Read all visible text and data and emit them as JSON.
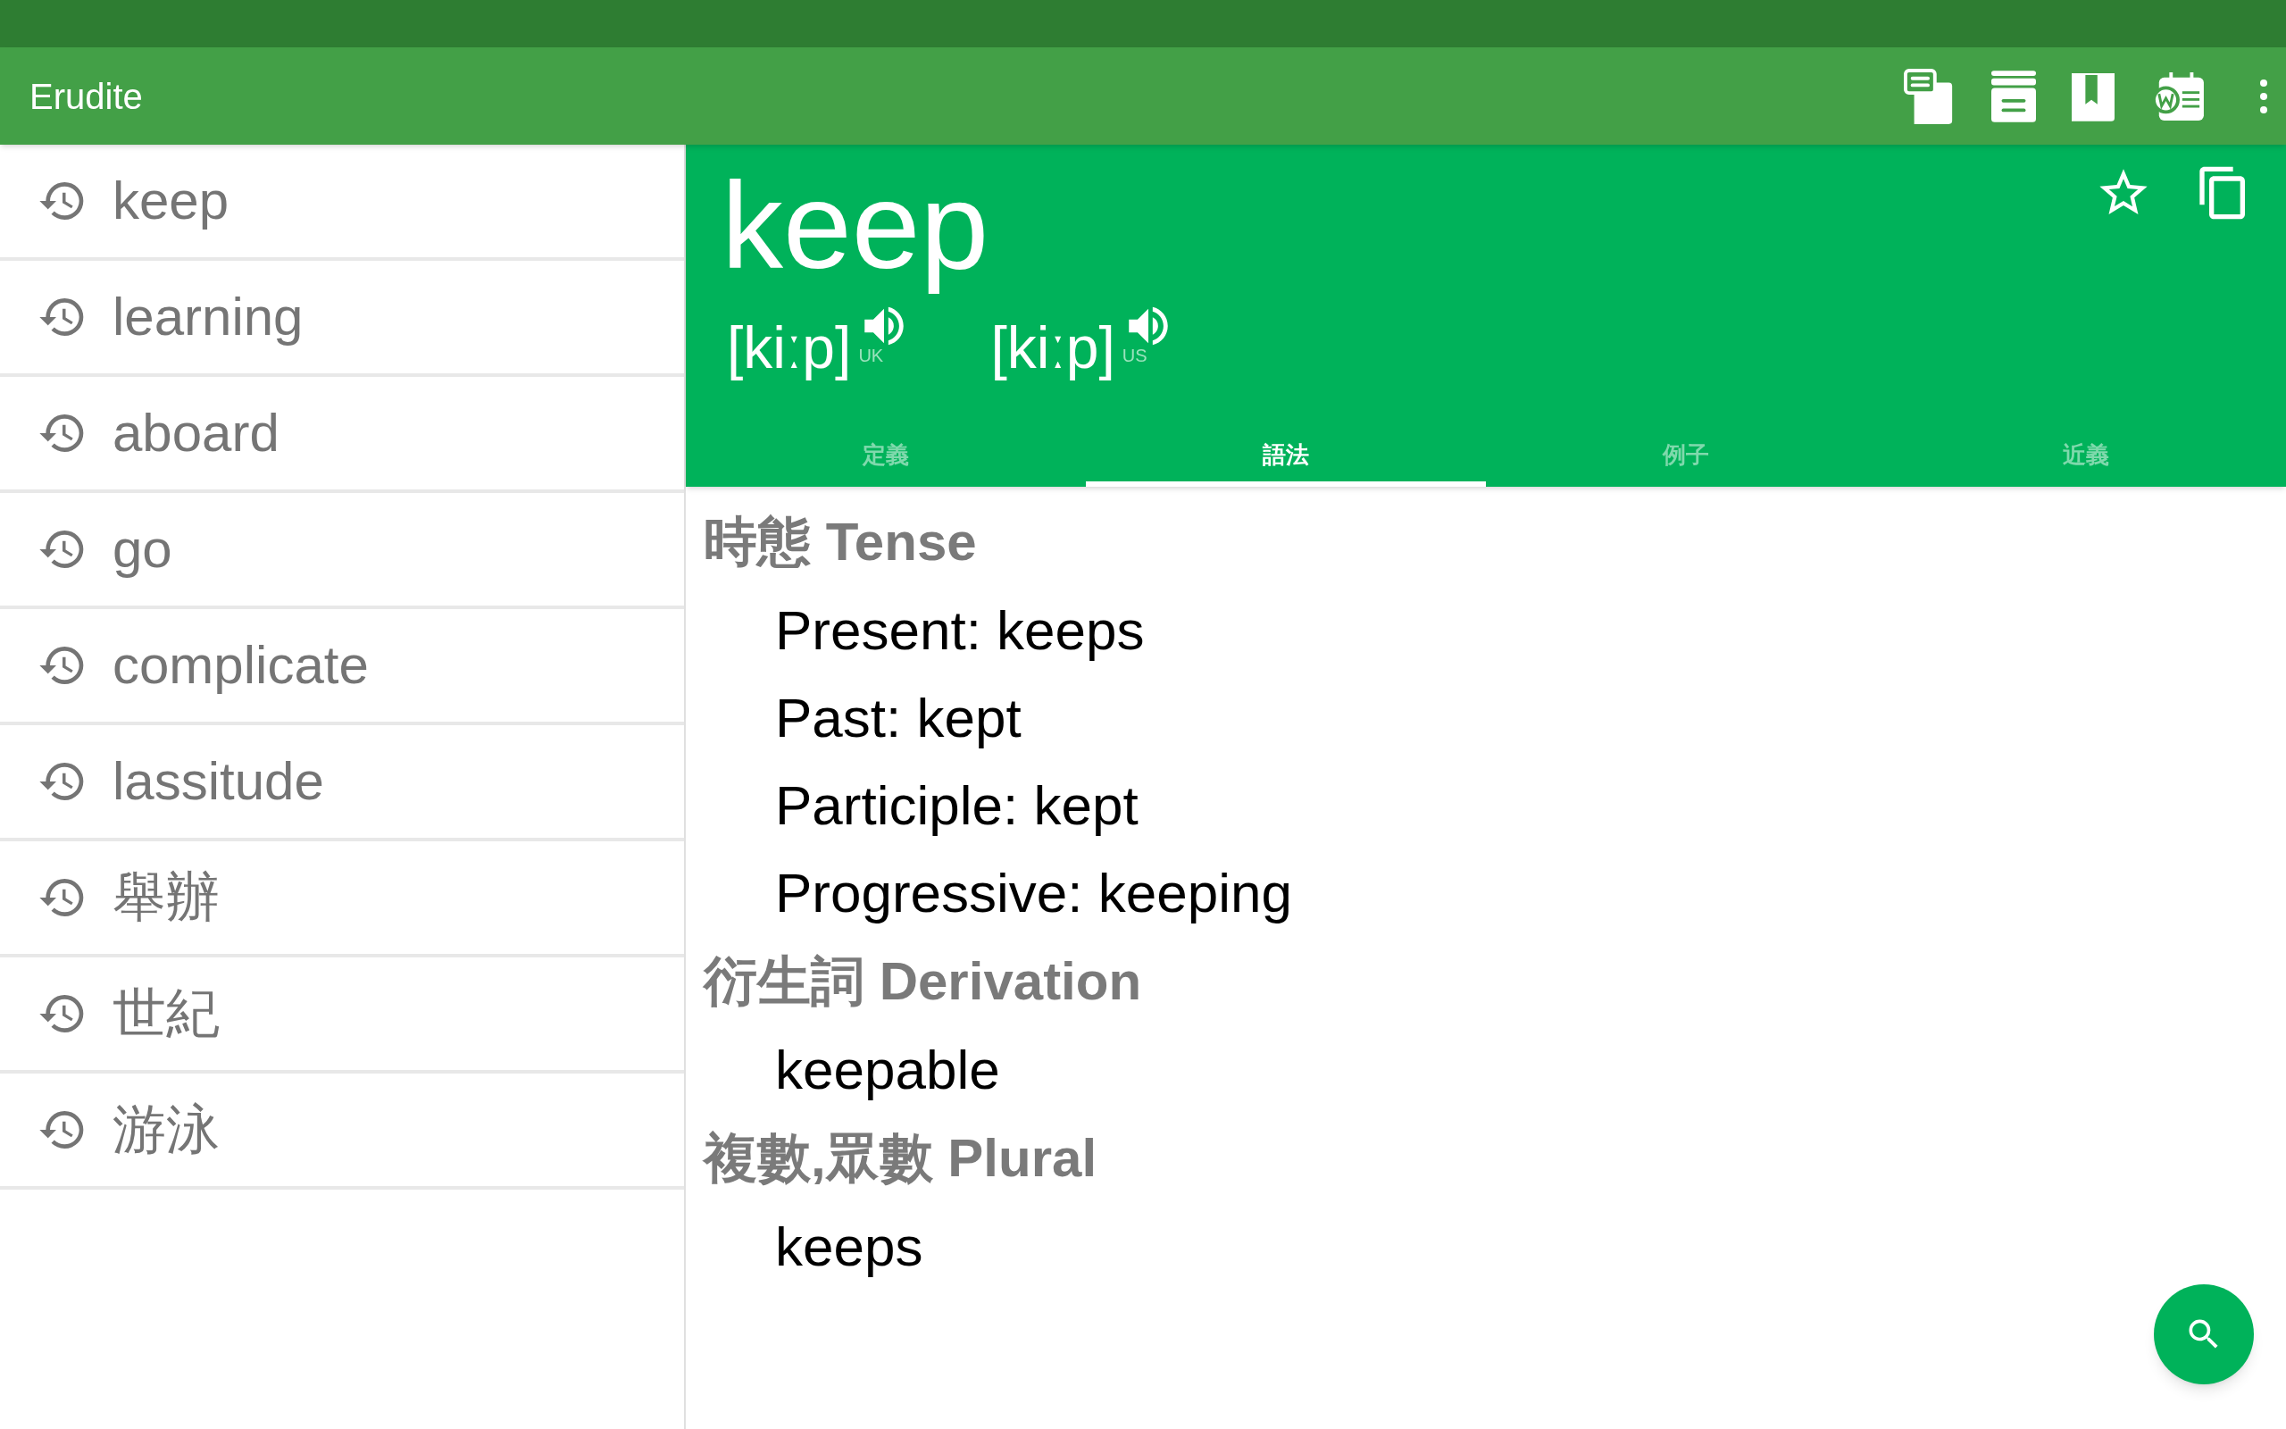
{
  "app_bar": {
    "title": "Erudite"
  },
  "history": [
    "keep",
    "learning",
    "aboard",
    "go",
    "complicate",
    "lassitude",
    "舉辦",
    "世紀",
    "游泳"
  ],
  "entry": {
    "word": "keep",
    "pronunciations": [
      {
        "ipa": "[kiːp]",
        "region": "UK"
      },
      {
        "ipa": "[kiːp]",
        "region": "US"
      }
    ]
  },
  "tabs": [
    {
      "label": "定義",
      "selected": false
    },
    {
      "label": "語法",
      "selected": true
    },
    {
      "label": "例子",
      "selected": false
    },
    {
      "label": "近義",
      "selected": false
    }
  ],
  "sections": [
    {
      "heading": "時態 Tense",
      "items": [
        "Present: keeps",
        "Past: kept",
        "Participle: kept",
        "Progressive: keeping"
      ]
    },
    {
      "heading": "衍生詞 Derivation",
      "items": [
        "keepable"
      ]
    },
    {
      "heading": "複數,眾數 Plural",
      "items": [
        "keeps"
      ]
    }
  ]
}
